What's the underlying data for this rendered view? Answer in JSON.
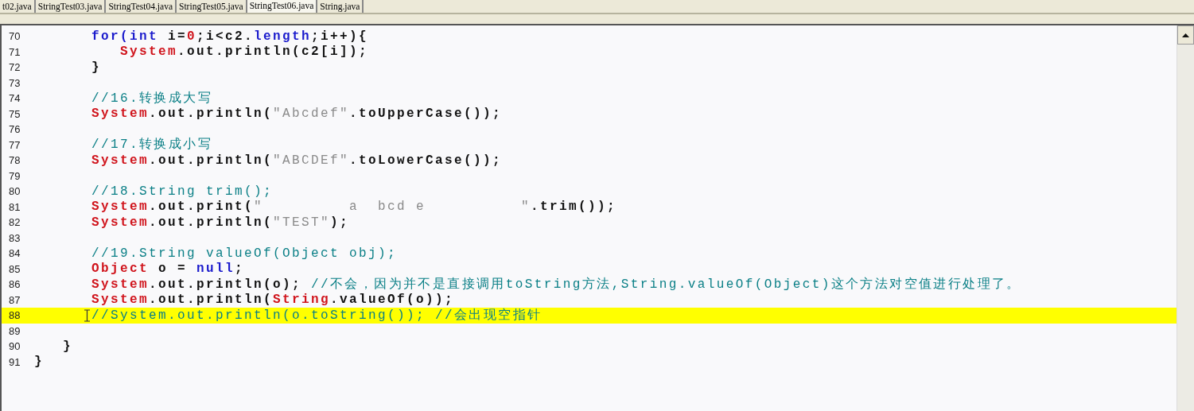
{
  "tabs": [
    {
      "label": "t02.java",
      "selected": false
    },
    {
      "label": "StringTest03.java",
      "selected": false
    },
    {
      "label": "StringTest04.java",
      "selected": false
    },
    {
      "label": "StringTest05.java",
      "selected": false
    },
    {
      "label": "StringTest06.java",
      "selected": true
    },
    {
      "label": "String.java",
      "selected": false
    }
  ],
  "editor": {
    "lines": [
      {
        "number": "70",
        "highlighted": false,
        "tokens": [
          {
            "kind": "keyword",
            "text": "      for("
          },
          {
            "kind": "keyword",
            "text": "int"
          },
          {
            "kind": "plain",
            "text": " i="
          },
          {
            "kind": "number",
            "text": "0"
          },
          {
            "kind": "plain",
            "text": ";i<c2."
          },
          {
            "kind": "field",
            "text": "length"
          },
          {
            "kind": "plain",
            "text": ";i++){"
          }
        ]
      },
      {
        "number": "71",
        "highlighted": false,
        "tokens": [
          {
            "kind": "class",
            "text": "         System"
          },
          {
            "kind": "plain",
            "text": ".out.println(c2[i]);"
          }
        ]
      },
      {
        "number": "72",
        "highlighted": false,
        "tokens": [
          {
            "kind": "plain",
            "text": "      }"
          }
        ]
      },
      {
        "number": "73",
        "highlighted": false
      },
      {
        "number": "74",
        "highlighted": false,
        "tokens": [
          {
            "kind": "comment",
            "text": "      //16.转换成大写"
          }
        ]
      },
      {
        "number": "75",
        "highlighted": false,
        "tokens": [
          {
            "kind": "class",
            "text": "      System"
          },
          {
            "kind": "plain",
            "text": ".out.println("
          },
          {
            "kind": "string",
            "text": "\"Abcdef\""
          },
          {
            "kind": "plain",
            "text": ".toUpperCase());"
          }
        ]
      },
      {
        "number": "76",
        "highlighted": false
      },
      {
        "number": "77",
        "highlighted": false,
        "tokens": [
          {
            "kind": "comment",
            "text": "      //17.转换成小写"
          }
        ]
      },
      {
        "number": "78",
        "highlighted": false,
        "tokens": [
          {
            "kind": "class",
            "text": "      System"
          },
          {
            "kind": "plain",
            "text": ".out.println("
          },
          {
            "kind": "string",
            "text": "\"ABCDEf\""
          },
          {
            "kind": "plain",
            "text": ".toLowerCase());"
          }
        ]
      },
      {
        "number": "79",
        "highlighted": false
      },
      {
        "number": "80",
        "highlighted": false,
        "tokens": [
          {
            "kind": "comment",
            "text": "      //18.String trim();"
          }
        ]
      },
      {
        "number": "81",
        "highlighted": false,
        "tokens": [
          {
            "kind": "class",
            "text": "      System"
          },
          {
            "kind": "plain",
            "text": ".out.print("
          },
          {
            "kind": "string",
            "text": "\"         a  bcd e          \""
          },
          {
            "kind": "plain",
            "text": ".trim());"
          }
        ]
      },
      {
        "number": "82",
        "highlighted": false,
        "tokens": [
          {
            "kind": "class",
            "text": "      System"
          },
          {
            "kind": "plain",
            "text": ".out.println("
          },
          {
            "kind": "string",
            "text": "\"TEST\""
          },
          {
            "kind": "plain",
            "text": ");"
          }
        ]
      },
      {
        "number": "83",
        "highlighted": false
      },
      {
        "number": "84",
        "highlighted": false,
        "tokens": [
          {
            "kind": "comment",
            "text": "      //19.String valueOf(Object obj);"
          }
        ]
      },
      {
        "number": "85",
        "highlighted": false,
        "tokens": [
          {
            "kind": "class",
            "text": "      Object"
          },
          {
            "kind": "plain",
            "text": " o = "
          },
          {
            "kind": "keyword",
            "text": "null"
          },
          {
            "kind": "plain",
            "text": ";"
          }
        ]
      },
      {
        "number": "86",
        "highlighted": false,
        "tokens": [
          {
            "kind": "class",
            "text": "      System"
          },
          {
            "kind": "plain",
            "text": ".out.println(o); "
          },
          {
            "kind": "comment",
            "text": "//不会，因为并不是直接调用toString方法,String.valueOf(Object)这个方法对空值进行处理了。"
          }
        ]
      },
      {
        "number": "87",
        "highlighted": false,
        "tokens": [
          {
            "kind": "class",
            "text": "      System"
          },
          {
            "kind": "plain",
            "text": ".out.println("
          },
          {
            "kind": "class",
            "text": "String"
          },
          {
            "kind": "plain",
            "text": ".valueOf(o));"
          }
        ]
      },
      {
        "number": "88",
        "highlighted": true,
        "tokens": [
          {
            "kind": "comment",
            "text": "      //System.out.println(o.toString()); //会出现空指针"
          }
        ]
      },
      {
        "number": "89",
        "highlighted": false
      },
      {
        "number": "90",
        "highlighted": false,
        "tokens": [
          {
            "kind": "plain",
            "text": "   }"
          }
        ]
      },
      {
        "number": "91",
        "highlighted": false,
        "tokens": [
          {
            "kind": "plain",
            "text": "}"
          }
        ]
      }
    ]
  }
}
